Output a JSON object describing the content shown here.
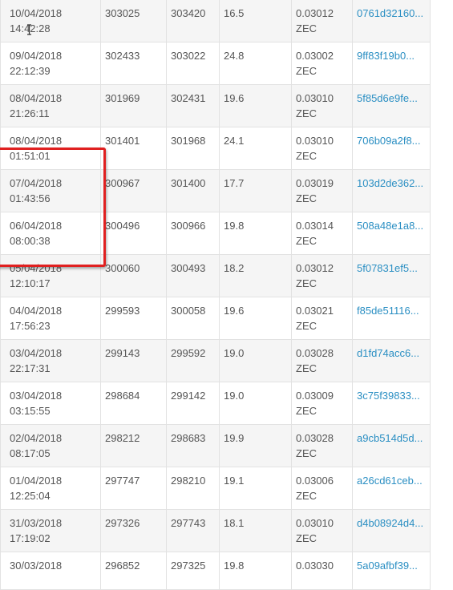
{
  "rows": [
    {
      "date": "10/04/2018",
      "time": "14:42:28",
      "start": "303025",
      "end": "303420",
      "value": "16.5",
      "rate": "0.03012",
      "unit": "ZEC",
      "hash": "0761d32160..."
    },
    {
      "date": "09/04/2018",
      "time": "22:12:39",
      "start": "302433",
      "end": "303022",
      "value": "24.8",
      "rate": "0.03002",
      "unit": "ZEC",
      "hash": "9ff83f19b0..."
    },
    {
      "date": "08/04/2018",
      "time": "21:26:11",
      "start": "301969",
      "end": "302431",
      "value": "19.6",
      "rate": "0.03010",
      "unit": "ZEC",
      "hash": "5f85d6e9fe..."
    },
    {
      "date": "08/04/2018",
      "time": "01:51:01",
      "start": "301401",
      "end": "301968",
      "value": "24.1",
      "rate": "0.03010",
      "unit": "ZEC",
      "hash": "706b09a2f8..."
    },
    {
      "date": "07/04/2018",
      "time": "01:43:56",
      "start": "300967",
      "end": "301400",
      "value": "17.7",
      "rate": "0.03019",
      "unit": "ZEC",
      "hash": "103d2de362..."
    },
    {
      "date": "06/04/2018",
      "time": "08:00:38",
      "start": "300496",
      "end": "300966",
      "value": "19.8",
      "rate": "0.03014",
      "unit": "ZEC",
      "hash": "508a48e1a8..."
    },
    {
      "date": "05/04/2018",
      "time": "12:10:17",
      "start": "300060",
      "end": "300493",
      "value": "18.2",
      "rate": "0.03012",
      "unit": "ZEC",
      "hash": "5f07831ef5..."
    },
    {
      "date": "04/04/2018",
      "time": "17:56:23",
      "start": "299593",
      "end": "300058",
      "value": "19.6",
      "rate": "0.03021",
      "unit": "ZEC",
      "hash": "f85de51116..."
    },
    {
      "date": "03/04/2018",
      "time": "22:17:31",
      "start": "299143",
      "end": "299592",
      "value": "19.0",
      "rate": "0.03028",
      "unit": "ZEC",
      "hash": "d1fd74acc6..."
    },
    {
      "date": "03/04/2018",
      "time": "03:15:55",
      "start": "298684",
      "end": "299142",
      "value": "19.0",
      "rate": "0.03009",
      "unit": "ZEC",
      "hash": "3c75f39833..."
    },
    {
      "date": "02/04/2018",
      "time": "08:17:05",
      "start": "298212",
      "end": "298683",
      "value": "19.9",
      "rate": "0.03028",
      "unit": "ZEC",
      "hash": "a9cb514d5d..."
    },
    {
      "date": "01/04/2018",
      "time": "12:25:04",
      "start": "297747",
      "end": "298210",
      "value": "19.1",
      "rate": "0.03006",
      "unit": "ZEC",
      "hash": "a26cd61ceb..."
    },
    {
      "date": "31/03/2018",
      "time": "17:19:02",
      "start": "297326",
      "end": "297743",
      "value": "18.1",
      "rate": "0.03010",
      "unit": "ZEC",
      "hash": "d4b08924d4..."
    },
    {
      "date": "30/03/2018",
      "time": "",
      "start": "296852",
      "end": "297325",
      "value": "19.8",
      "rate": "0.03030",
      "unit": "",
      "hash": "5a09afbf39..."
    }
  ],
  "colors": {
    "link": "#2b8fc3",
    "highlight": "#e02020"
  },
  "icons": {
    "cursor": "text-cursor-icon"
  }
}
